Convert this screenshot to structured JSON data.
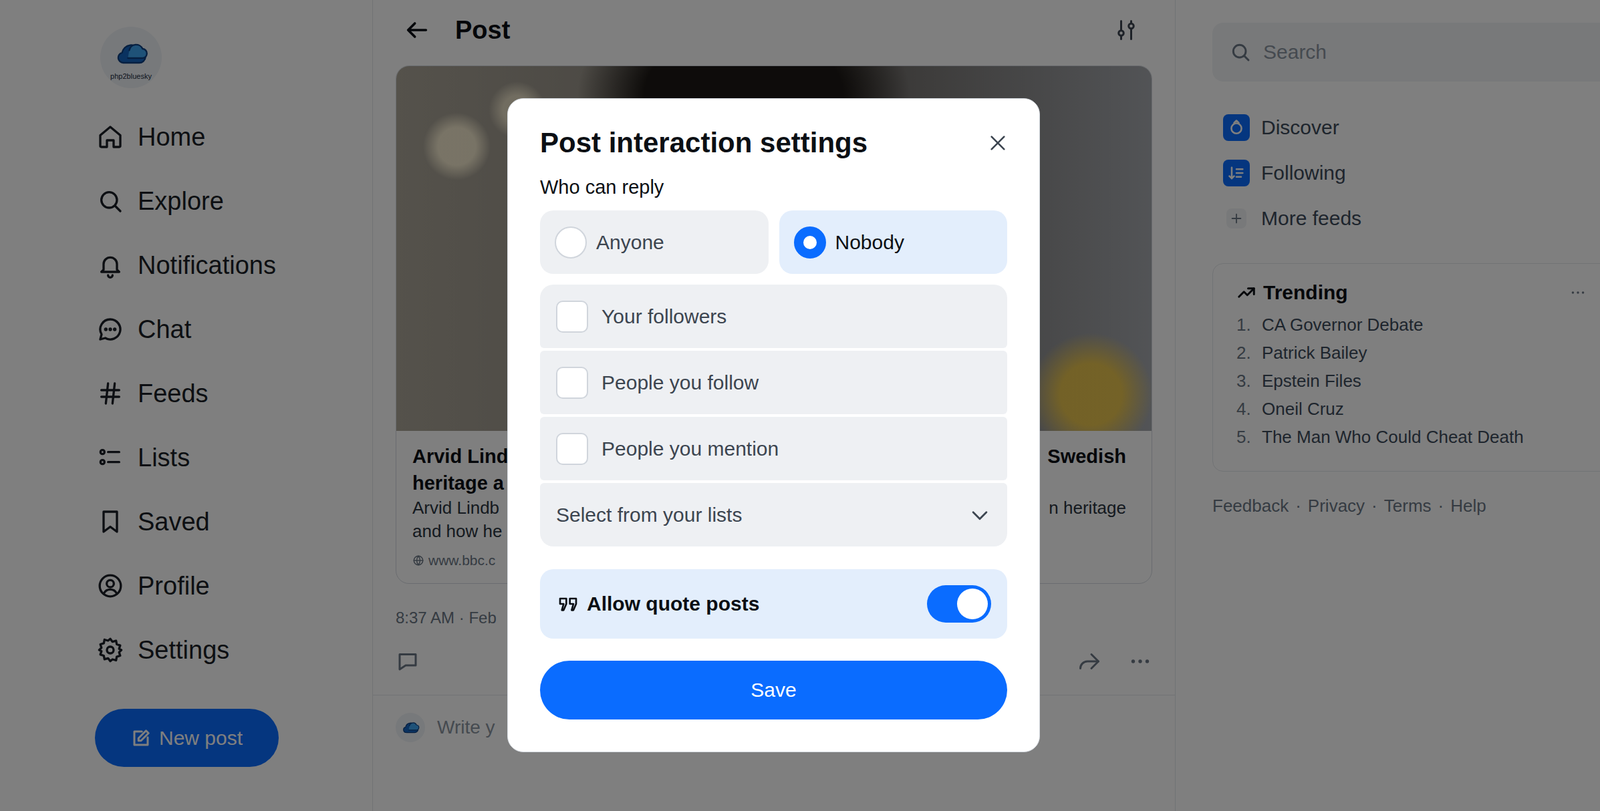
{
  "logo": {
    "text": "php2bluesky"
  },
  "sidebar": {
    "items": [
      {
        "label": "Home"
      },
      {
        "label": "Explore"
      },
      {
        "label": "Notifications"
      },
      {
        "label": "Chat"
      },
      {
        "label": "Feeds"
      },
      {
        "label": "Lists"
      },
      {
        "label": "Saved"
      },
      {
        "label": "Profile"
      },
      {
        "label": "Settings"
      }
    ],
    "new_post": "New post"
  },
  "post": {
    "title": "Post",
    "link_card": {
      "left_title": [
        "Arvid Lind",
        "heritage a"
      ],
      "left_description": [
        "Arvid Lindb",
        "and how he"
      ],
      "domain": "www.bbc.c",
      "right_title": "Swedish",
      "right_description": "n heritage"
    },
    "timestamp": "8:37 AM · Feb",
    "reply_placeholder": "Write y"
  },
  "search": {
    "placeholder": "Search"
  },
  "feeds": [
    {
      "label": "Discover",
      "kind": "feed"
    },
    {
      "label": "Following",
      "kind": "feed"
    },
    {
      "label": "More feeds",
      "kind": "add"
    }
  ],
  "trending": {
    "title": "Trending",
    "items": [
      {
        "rank": "1.",
        "label": "CA Governor Debate"
      },
      {
        "rank": "2.",
        "label": "Patrick Bailey"
      },
      {
        "rank": "3.",
        "label": "Epstein Files"
      },
      {
        "rank": "4.",
        "label": "Oneil Cruz"
      },
      {
        "rank": "5.",
        "label": "The Man Who Could Cheat Death"
      }
    ]
  },
  "footer": {
    "links": [
      "Feedback",
      "Privacy",
      "Terms",
      "Help"
    ],
    "separator": "·"
  },
  "dialog": {
    "title": "Post interaction settings",
    "section": "Who can reply",
    "reply_options": [
      {
        "label": "Anyone",
        "selected": false
      },
      {
        "label": "Nobody",
        "selected": true
      }
    ],
    "audiences": [
      {
        "label": "Your followers",
        "checked": false
      },
      {
        "label": "People you follow",
        "checked": false
      },
      {
        "label": "People you mention",
        "checked": false
      }
    ],
    "list_select": {
      "placeholder": "Select from your lists",
      "expanded": false
    },
    "quote_posts": {
      "label": "Allow quote posts",
      "on": true
    },
    "save": "Save"
  }
}
